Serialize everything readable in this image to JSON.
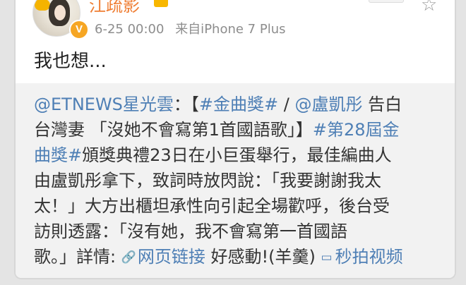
{
  "post": {
    "author": "江疏影",
    "time": "6-25 00:00",
    "source": "来自iPhone 7 Plus",
    "text": "我也想..."
  },
  "icons": {
    "avatar": "avatar",
    "verified": "verified-badge-icon",
    "vip": "vip-icon",
    "star": "star-icon",
    "link": "link-icon",
    "video": "video-icon"
  },
  "repost": {
    "line1_mention": "@ETNEWS星光雲",
    "line1_text1": "：【",
    "line1_topic": "#金曲獎#",
    "line1_text2": " / ",
    "line1_mention2": "@盧凱彤",
    "line1_text3": " 告白",
    "line2_text1": "台灣妻 「沒她不會寫第1首國語歌」】",
    "line2_topic": "#第28屆金",
    "line3_topic": "曲獎#",
    "line3_text": "頒獎典禮23日在小巨蛋舉行，最佳編曲人",
    "line4_text": "由盧凱彤拿下，致詞時放閃說：「我要謝謝我太",
    "line5_text": "太！」大方出櫃坦承性向引起全場歡呼，後台受",
    "line6_text": "訪則透露：「沒有她，我不會寫第一首國語",
    "line7_text1": "歌。」詳情:",
    "line7_link": "网页链接",
    "line7_text2": " 好感動!(羊羹) ",
    "line7_video": "秒拍视频"
  },
  "colors": {
    "accent_blue": "#4e7fb5",
    "author_orange": "#ef7d32",
    "repost_bg": "#f2f2f2"
  }
}
